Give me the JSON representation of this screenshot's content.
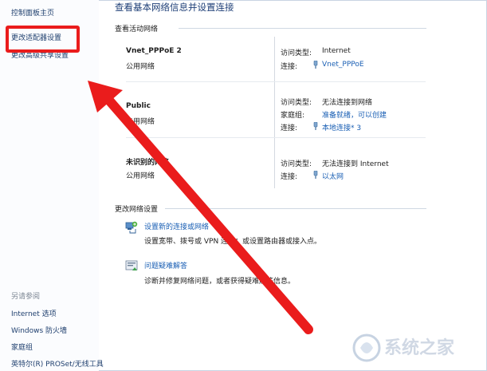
{
  "sidebar": {
    "home": "控制面板主页",
    "change_adapter": "更改适配器设置",
    "change_sharing": "更改高级共享设置",
    "see_also": "另请参阅",
    "links": [
      "Internet 选项",
      "Windows 防火墙",
      "家庭组",
      "英特尔(R) PROSet/无线工具"
    ]
  },
  "main": {
    "title": "查看基本网络信息并设置连接",
    "active_networks_heading": "查看活动网络",
    "change_settings_heading": "更改网络设置"
  },
  "networks": [
    {
      "name": "Vnet_PPPoE 2",
      "type": "公用网络",
      "access_label": "访问类型:",
      "access_value": "Internet",
      "connection_label": "连接:",
      "connection_value": "Vnet_PPPoE"
    },
    {
      "name": "Public",
      "type": "专用网络",
      "access_label": "访问类型:",
      "access_value": "无法连接到网络",
      "homegroup_label": "家庭组:",
      "homegroup_value": "准备就绪，可以创建",
      "connection_label": "连接:",
      "connection_value": "本地连接* 3"
    },
    {
      "name": "未识别的网络",
      "type": "公用网络",
      "access_label": "访问类型:",
      "access_value": "无法连接到 Internet",
      "connection_label": "连接:",
      "connection_value": "以太网"
    }
  ],
  "tasks": [
    {
      "link": "设置新的连接或网络",
      "desc": "设置宽带、拨号或 VPN 连接；或设置路由器或接入点。"
    },
    {
      "link": "问题疑难解答",
      "desc": "诊断并修复网络问题，或者获得疑难解答信息。"
    }
  ],
  "watermark": {
    "text": "系统之家"
  },
  "colors": {
    "annotation": "#ea1c1c",
    "link": "#1a5fb4",
    "title": "#1e3f77"
  }
}
